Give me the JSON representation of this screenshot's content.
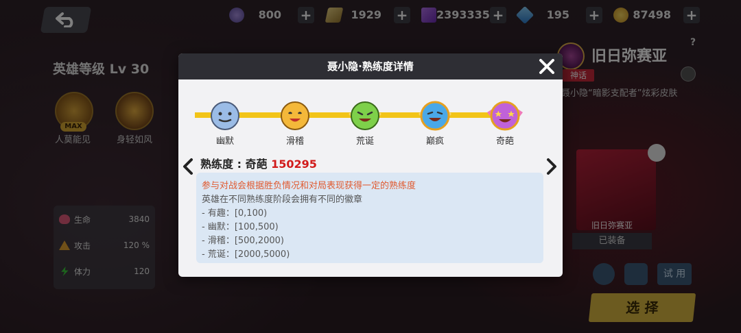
{
  "currencies": [
    {
      "icon": "purple-coin-icon",
      "value": "800"
    },
    {
      "icon": "card-ticket-icon",
      "value": "1929"
    },
    {
      "icon": "purple-cube-icon",
      "value": "2393335"
    },
    {
      "icon": "blue-diamond-icon",
      "value": "195"
    },
    {
      "icon": "gold-coin-icon",
      "value": "87498"
    }
  ],
  "hero": {
    "level": "英雄等级 Lv 30",
    "skills": [
      {
        "label": "人莫能见",
        "badge": "MAX"
      },
      {
        "label": "身轻如风"
      }
    ],
    "stats": [
      {
        "label": "生命",
        "value": "3840",
        "color": "#e05a7a"
      },
      {
        "label": "攻击",
        "value": "120 %",
        "color": "#e0a030"
      },
      {
        "label": "体力",
        "value": "120",
        "color": "#3ac83a"
      }
    ]
  },
  "skin": {
    "name": "旧日弥赛亚",
    "rarity": "神话",
    "description": "聂小隐“暗影支配者”炫彩皮肤",
    "card_label": "旧日弥赛亚",
    "equipped_label": "已装备",
    "try_label": "试 用",
    "select_label": "选 择",
    "help": "?"
  },
  "modal": {
    "title": "聂小隐·熟练度详情",
    "levels": [
      {
        "label": "幽默",
        "color": "#9bbce6"
      },
      {
        "label": "滑稽",
        "color": "#f4b83a"
      },
      {
        "label": "荒诞",
        "color": "#7ed04a"
      },
      {
        "label": "巅疯",
        "color": "#4aa8e8"
      },
      {
        "label": "奇葩",
        "color": "#c062d8"
      }
    ],
    "proficiency_prefix": "熟练度 : 奇葩",
    "proficiency_value": "150295",
    "info_highlight": "参与对战会根据胜负情况和对局表现获得一定的熟练度",
    "info_lines": [
      "英雄在不同熟练度阶段会拥有不同的徽章",
      "-   有趣：[0,100)",
      "-   幽默：[100,500)",
      "-   滑稽：[500,2000)",
      "-   荒诞：[2000,5000)"
    ]
  }
}
